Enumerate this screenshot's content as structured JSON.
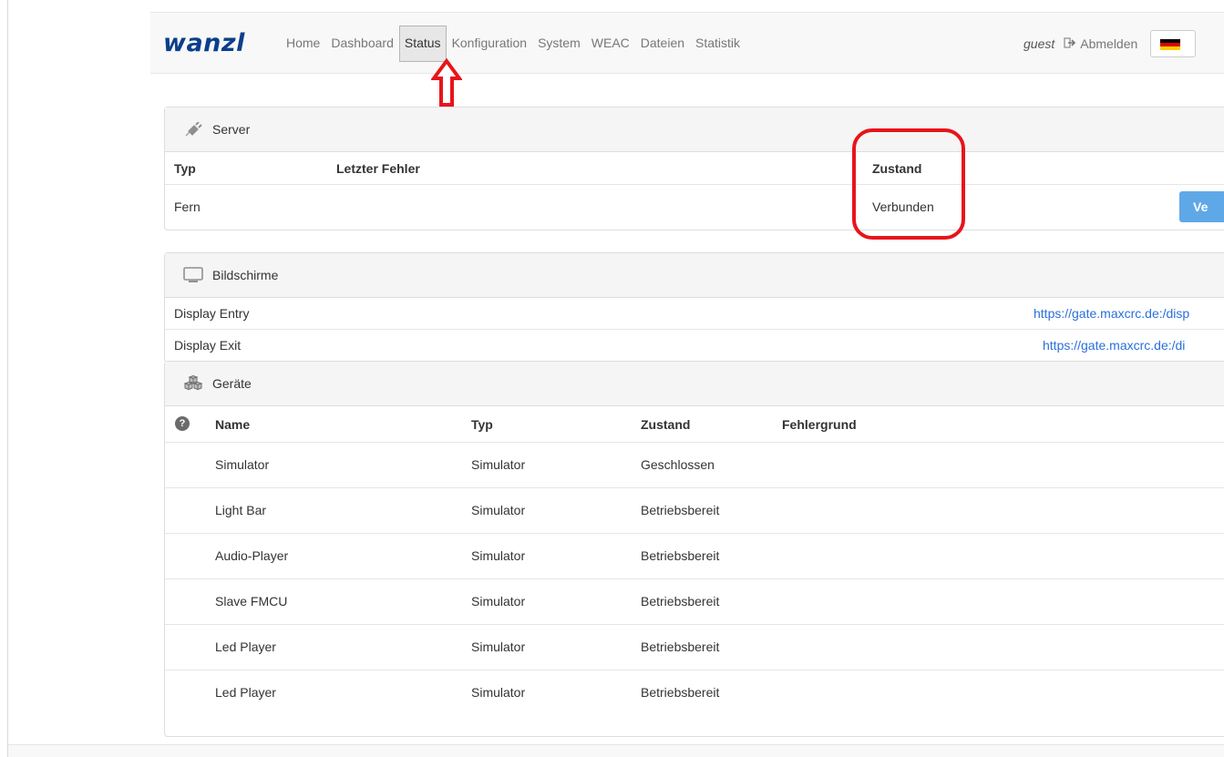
{
  "brand": {
    "logo_text": "wanzl"
  },
  "nav": {
    "items": [
      {
        "label": "Home"
      },
      {
        "label": "Dashboard"
      },
      {
        "label": "Status"
      },
      {
        "label": "Konfiguration"
      },
      {
        "label": "System"
      },
      {
        "label": "WEAC"
      },
      {
        "label": "Dateien"
      },
      {
        "label": "Statistik"
      }
    ],
    "active": "Status",
    "user": "guest",
    "logout_label": "Abmelden",
    "language_flag": "de-flag-icon"
  },
  "server": {
    "title": "Server",
    "icon": "plug-icon",
    "columns": {
      "type": "Typ",
      "last_error": "Letzter Fehler",
      "state": "Zustand"
    },
    "rows": [
      {
        "type": "Fern",
        "last_error": "",
        "state": "Verbunden",
        "action_label": "Ve"
      }
    ]
  },
  "screens": {
    "title": "Bildschirme",
    "icon": "monitor-icon",
    "rows": [
      {
        "name": "Display Entry",
        "url": "https://gate.maxcrc.de:/disp"
      },
      {
        "name": "Display Exit",
        "url": "https://gate.maxcrc.de:/di"
      }
    ]
  },
  "devices": {
    "title": "Geräte",
    "icon": "cubes-icon",
    "columns": {
      "help": "?",
      "name": "Name",
      "type": "Typ",
      "state": "Zustand",
      "error": "Fehlergrund"
    },
    "rows": [
      {
        "name": "Simulator",
        "type": "Simulator",
        "state": "Geschlossen",
        "error": ""
      },
      {
        "name": "Light Bar",
        "type": "Simulator",
        "state": "Betriebsbereit",
        "error": ""
      },
      {
        "name": "Audio-Player",
        "type": "Simulator",
        "state": "Betriebsbereit",
        "error": ""
      },
      {
        "name": "Slave FMCU",
        "type": "Simulator",
        "state": "Betriebsbereit",
        "error": ""
      },
      {
        "name": "Led Player",
        "type": "Simulator",
        "state": "Betriebsbereit",
        "error": ""
      },
      {
        "name": "Led Player",
        "type": "Simulator",
        "state": "Betriebsbereit",
        "error": ""
      }
    ]
  },
  "colors": {
    "brand": "#0b3f8c",
    "link": "#2a6fdb",
    "button": "#5fa8e8",
    "annotation": "#e8141b"
  }
}
